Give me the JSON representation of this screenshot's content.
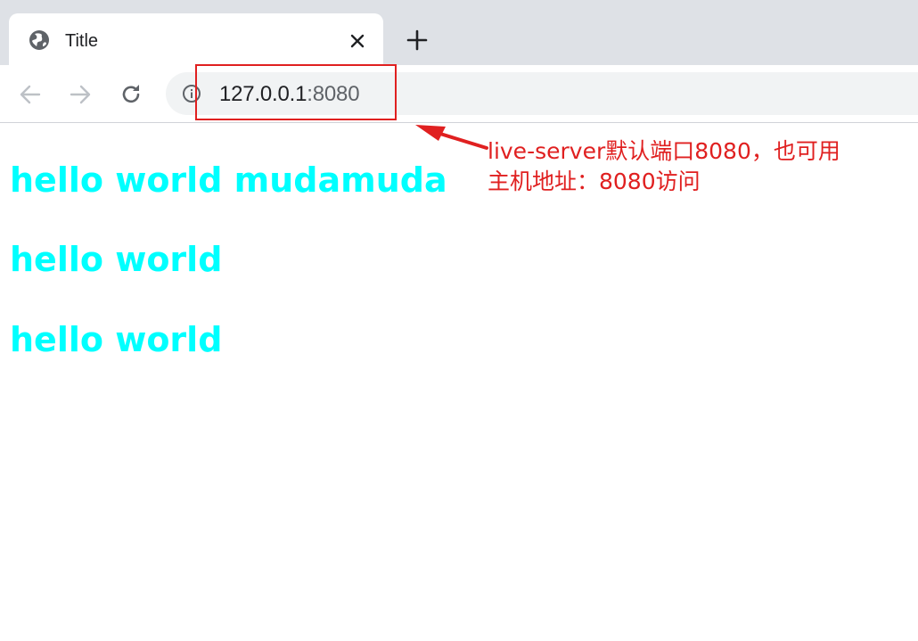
{
  "tab": {
    "title": "Title",
    "favicon": "globe-icon"
  },
  "toolbar": {
    "back": "arrow-left-icon",
    "forward": "arrow-right-icon",
    "reload": "reload-icon",
    "url_host": "127.0.0.1",
    "url_port": ":8080",
    "info": "info-icon"
  },
  "page": {
    "headings": [
      "hello world mudamuda",
      "hello world",
      "hello world"
    ]
  },
  "annotation": {
    "line1": "live-server默认端口8080，也可用",
    "line2": "主机地址：8080访问",
    "color": "#e02020"
  }
}
